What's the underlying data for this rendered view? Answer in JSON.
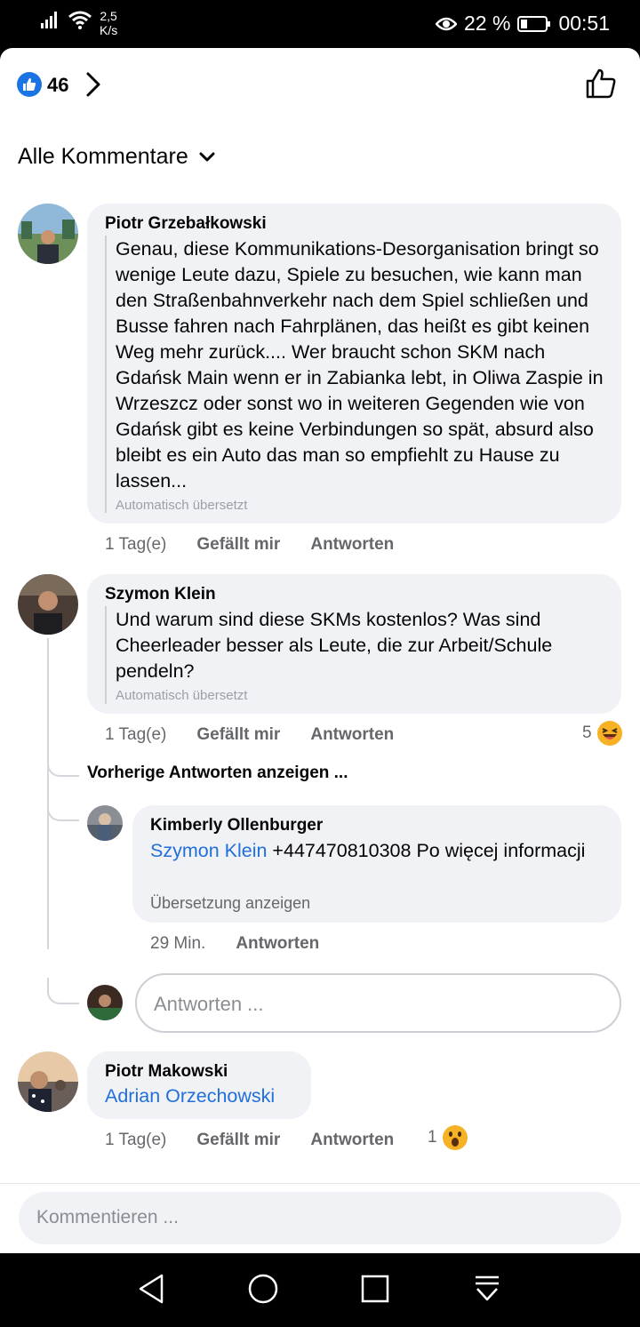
{
  "status_bar": {
    "speed_value": "2,5",
    "speed_unit": "K/s",
    "battery_percent": "22 %",
    "time": "00:51"
  },
  "reactions_header": {
    "like_count": "46",
    "icons": [
      "like-badge-icon",
      "chevron-right-icon",
      "thumbs-up-outline-icon"
    ]
  },
  "filter": {
    "label": "Alle Kommentare"
  },
  "comments": [
    {
      "author": "Piotr Grzebałkowski",
      "text": "Genau, diese Kommunikations-Desorganisation bringt so wenige Leute dazu, Spiele zu besuchen, wie kann man den Straßenbahnverkehr nach dem Spiel schließen und Busse fahren nach Fahrplänen, das heißt es gibt keinen Weg mehr zurück.... Wer braucht schon SKM nach Gdańsk Main wenn er in Zabianka lebt, in Oliwa Zaspie in Wrzeszcz oder sonst wo in weiteren Gegenden wie von Gdańsk gibt es keine Verbindungen so spät, absurd also bleibt es ein Auto das man so empfiehlt zu Hause zu lassen...",
      "translated_note": "Automatisch übersetzt",
      "time": "1 Tag(e)",
      "like_label": "Gefällt mir",
      "reply_label": "Antworten"
    },
    {
      "author": "Szymon Klein",
      "text": "Und warum sind diese SKMs kostenlos? Was sind Cheerleader besser als Leute, die zur Arbeit/Schule pendeln?",
      "translated_note": "Automatisch übersetzt",
      "time": "1 Tag(e)",
      "like_label": "Gefällt mir",
      "reply_label": "Antworten",
      "reaction_count": "5"
    },
    {
      "author": "Piotr Makowski",
      "mention": "Adrian Orzechowski",
      "time": "1 Tag(e)",
      "like_label": "Gefällt mir",
      "reply_label": "Antworten",
      "reaction_count": "1"
    }
  ],
  "previous_replies_label": "Vorherige Antworten anzeigen ...",
  "reply": {
    "author": "Kimberly Ollenburger",
    "mention": "Szymon Klein",
    "text": " +447470810308 Po więcej informacji",
    "see_translation": "Übersetzung anzeigen",
    "time": "29 Min.",
    "reply_label": "Antworten"
  },
  "reply_input": {
    "placeholder": "Antworten ..."
  },
  "comment_input": {
    "placeholder": "Kommentieren ..."
  },
  "colors": {
    "accent": "#1b74e4",
    "link": "#216fdb",
    "bubble": "#f0f2f5",
    "secondary_text": "#65676b"
  }
}
